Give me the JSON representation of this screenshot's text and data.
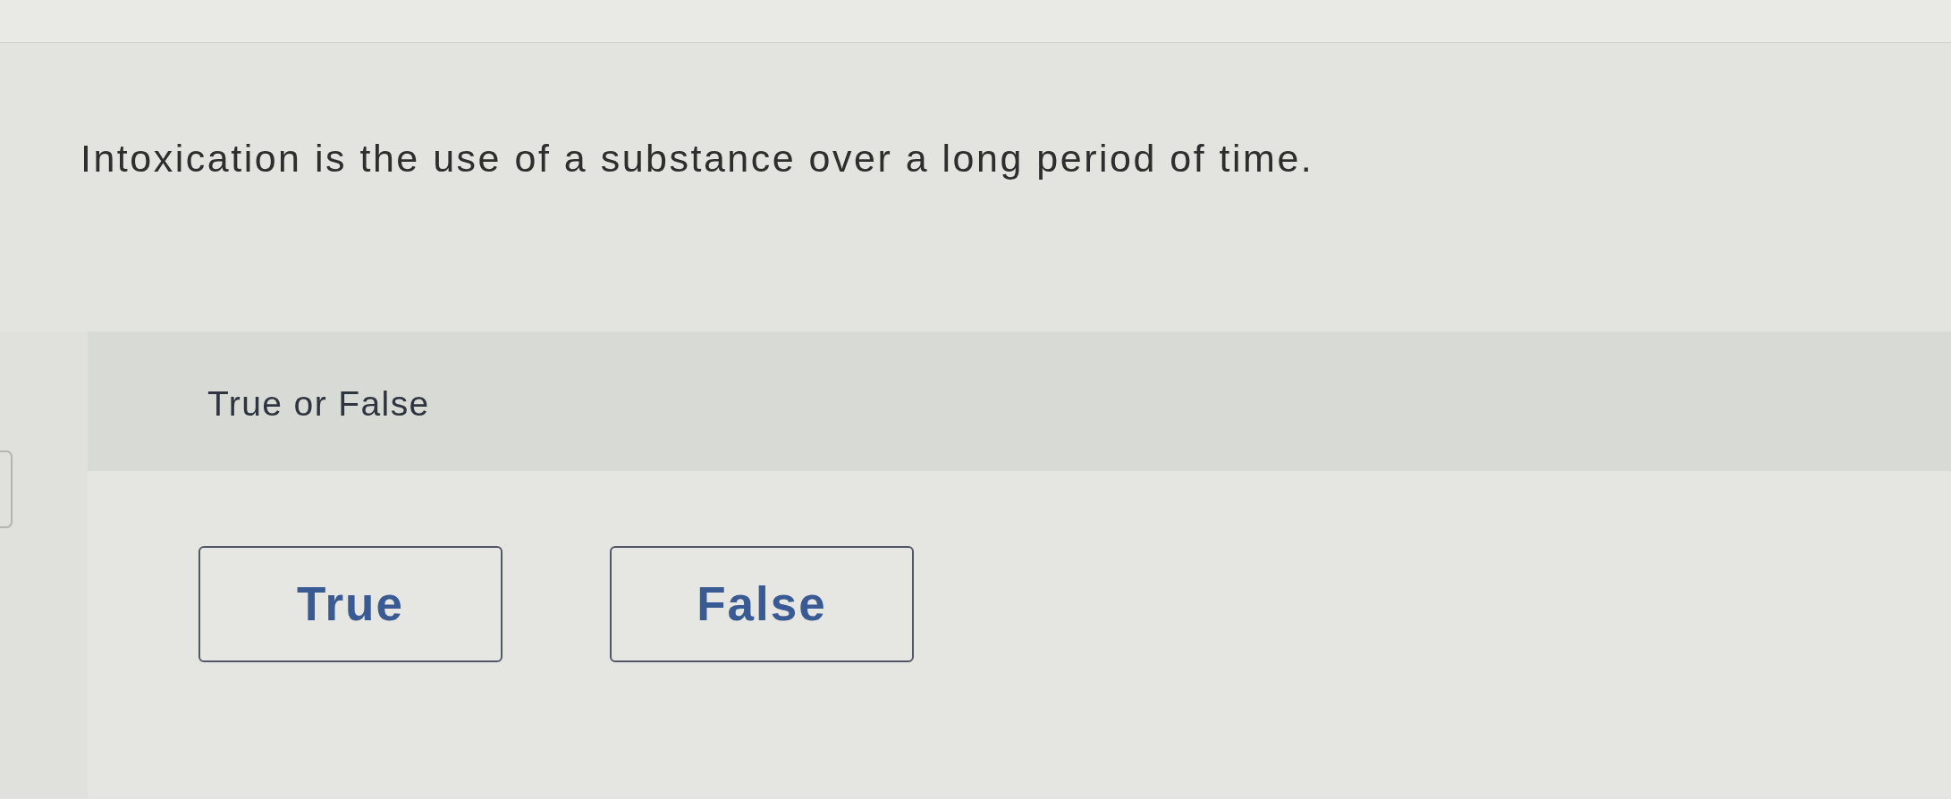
{
  "question": {
    "text": "Intoxication is the use of a substance over a long period of time."
  },
  "answer_panel": {
    "heading": "True or False",
    "options": [
      {
        "label": "True",
        "selected": false
      },
      {
        "label": "False",
        "selected": false
      }
    ]
  }
}
